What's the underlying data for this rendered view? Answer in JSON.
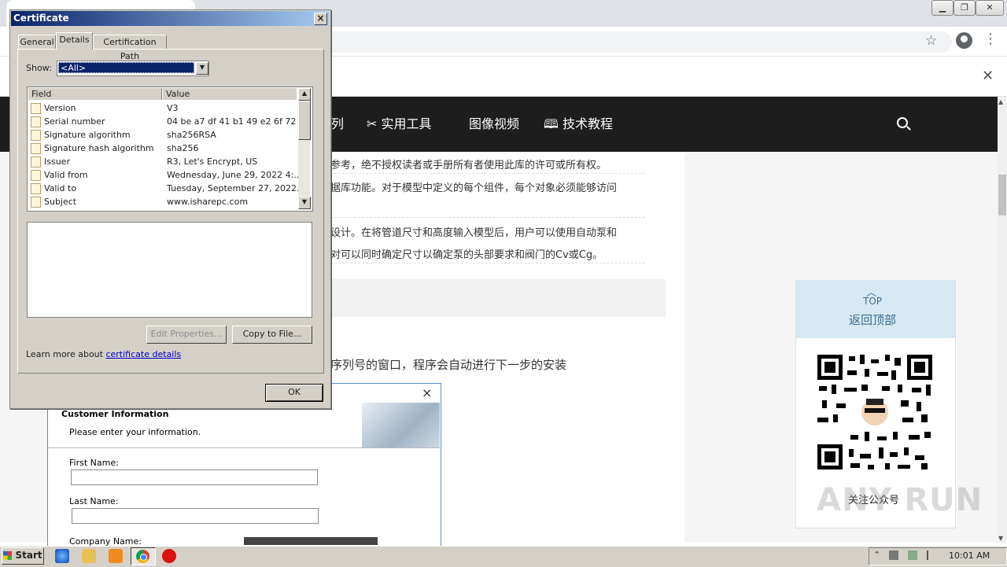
{
  "certificate": {
    "title": "Certificate",
    "tabs": [
      "General",
      "Details",
      "Certification Path"
    ],
    "show_label": "Show:",
    "show_value": "<All>",
    "columns": {
      "field": "Field",
      "value": "Value"
    },
    "rows": [
      {
        "field": "Version",
        "value": "V3"
      },
      {
        "field": "Serial number",
        "value": "04 be a7 df 41 b1 49 e2 6f 72 ..."
      },
      {
        "field": "Signature algorithm",
        "value": "sha256RSA"
      },
      {
        "field": "Signature hash algorithm",
        "value": "sha256"
      },
      {
        "field": "Issuer",
        "value": "R3, Let's Encrypt, US"
      },
      {
        "field": "Valid from",
        "value": "Wednesday, June 29, 2022 4:..."
      },
      {
        "field": "Valid to",
        "value": "Tuesday, September 27, 2022..."
      },
      {
        "field": "Subject",
        "value": "www.isharepc.com"
      }
    ],
    "edit_properties": "Edit Properties...",
    "copy_to_file": "Copy to File...",
    "learn_more": "Learn more about",
    "learn_more_link": "certificate details",
    "ok": "OK",
    "close": "×"
  },
  "site": {
    "nav": [
      "列",
      "实用工具",
      "图像视频",
      "技术教程"
    ],
    "lines": [
      "参考，绝不授权读者或手册所有者使用此库的许可或所有权。",
      "据库功能。对于模型中定义的每个组件，每个对象必须能够访问",
      "设计。在将管道尺寸和高度输入模型后，用户可以使用自动泵和",
      "对可以同时确定尺寸以确定泵的头部要求和阀门的Cv或Cg。",
      "序列号的窗口，程序会自动进行下一步的安装"
    ],
    "top_label": "TOP",
    "back_to_top": "返回顶部",
    "follow": "关注公众号"
  },
  "customer_dialog": {
    "heading": "Customer Information",
    "subtitle": "Please enter your information.",
    "first_name": "First Name:",
    "last_name": "Last Name:",
    "company": "Company Name:",
    "close": "×"
  },
  "watermark": "ANY RUN",
  "taskbar": {
    "start": "Start",
    "time": "10:01 AM"
  }
}
